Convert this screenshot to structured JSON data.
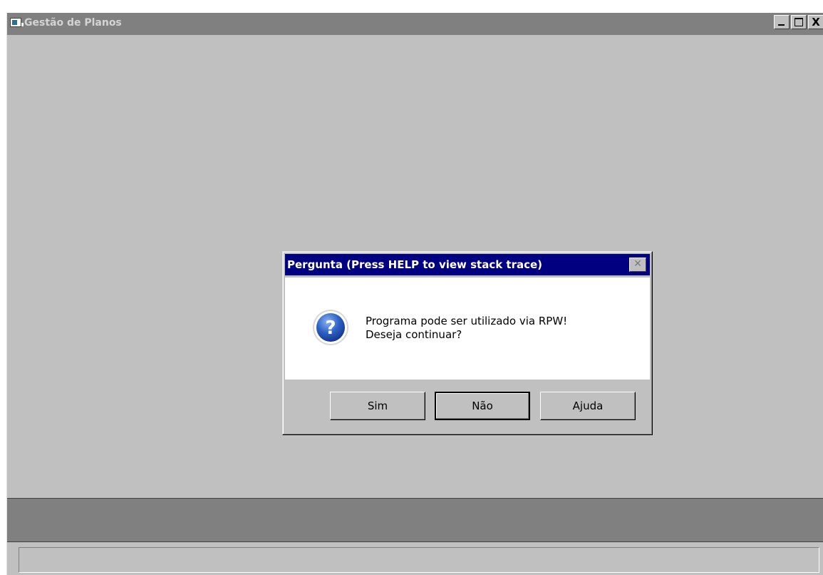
{
  "window": {
    "title": "Gestão de Planos",
    "icon": "app-icon",
    "controls": [
      "minimize-icon",
      "maximize-icon",
      "close-icon"
    ],
    "close_glyph": "X"
  },
  "dialog": {
    "title": "Pergunta (Press HELP to view stack trace)",
    "close_glyph": "✕",
    "icon": "question-icon",
    "message_line1": "Programa pode ser utilizado via RPW!",
    "message_line2": "Deseja continuar?",
    "buttons": {
      "yes": "Sim",
      "no": "Não",
      "help": "Ajuda"
    },
    "default_button": "no"
  },
  "colors": {
    "window_bg": "#c0c0c0",
    "inactive_titlebar": "#808080",
    "dialog_titlebar": "#000080",
    "status_bar": "#808080"
  }
}
